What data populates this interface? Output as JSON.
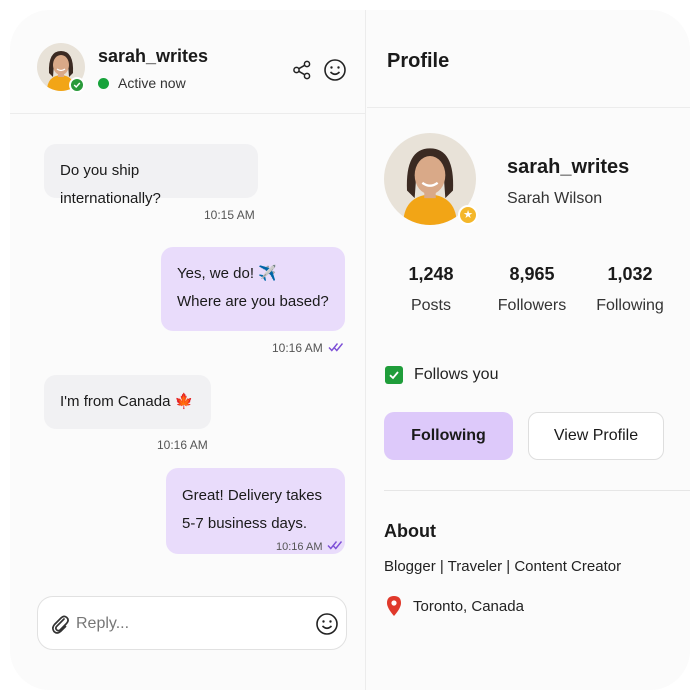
{
  "chat": {
    "username": "sarah_writes",
    "status": "Active now",
    "messages": [
      {
        "direction": "in",
        "lines": [
          "Do you ship internationally?"
        ],
        "time": "10:15 AM"
      },
      {
        "direction": "out",
        "lines": [
          "Yes, we do! ✈️",
          "Where are you based?"
        ],
        "time": "10:16 AM",
        "read": true
      },
      {
        "direction": "in",
        "lines": [
          "I'm from Canada 🍁"
        ],
        "time": "10:16 AM"
      },
      {
        "direction": "out",
        "lines": [
          "Great! Delivery takes",
          "5-7 business days."
        ],
        "time": "10:16 AM",
        "read": true
      }
    ],
    "reply": {
      "placeholder": "Reply..."
    }
  },
  "profile": {
    "title": "Profile",
    "username": "sarah_writes",
    "full_name": "Sarah Wilson",
    "stats": [
      {
        "value": "1,248",
        "label": "Posts"
      },
      {
        "value": "8,965",
        "label": "Followers"
      },
      {
        "value": "1,032",
        "label": "Following"
      }
    ],
    "follows_you": "Follows you",
    "buttons": {
      "following": "Following",
      "view_profile": "View Profile"
    },
    "about": {
      "title": "About",
      "bio": "Blogger | Traveler | Content Creator",
      "location": "Toronto, Canada"
    }
  },
  "colors": {
    "accent_purple": "#ddc9fa",
    "outgoing_bubble": "#e9dcfb",
    "incoming_bubble": "#f1f1f3",
    "online_green": "#17a33b",
    "check_green": "#1f9d3a",
    "badge_gold": "#f4b72a"
  }
}
